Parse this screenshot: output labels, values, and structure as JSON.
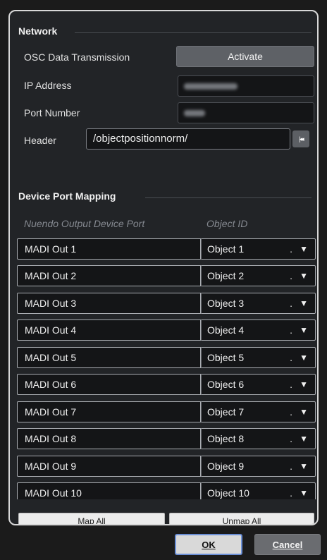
{
  "network": {
    "title": "Network",
    "osc_label": "OSC Data Transmission",
    "activate_label": "Activate",
    "ip_label": "IP Address",
    "port_label": "Port Number",
    "header_label": "Header",
    "header_value": "/objectpositionnorm/",
    "reset_icon": "|◂◂"
  },
  "mapping": {
    "title": "Device Port Mapping",
    "col_port": "Nuendo Output Device Port",
    "col_object": "Object ID",
    "rows": [
      {
        "port": "MADI Out 1",
        "object": "Object 1"
      },
      {
        "port": "MADI Out 2",
        "object": "Object 2"
      },
      {
        "port": "MADI Out 3",
        "object": "Object 3"
      },
      {
        "port": "MADI Out 4",
        "object": "Object 4"
      },
      {
        "port": "MADI Out 5",
        "object": "Object 5"
      },
      {
        "port": "MADI Out 6",
        "object": "Object 6"
      },
      {
        "port": "MADI Out 7",
        "object": "Object 7"
      },
      {
        "port": "MADI Out 8",
        "object": "Object 8"
      },
      {
        "port": "MADI Out 9",
        "object": "Object 9"
      },
      {
        "port": "MADI Out 10",
        "object": "Object 10"
      }
    ],
    "map_all_label": "Map All",
    "unmap_all_label": "Unmap All"
  },
  "dialog": {
    "ok_label": "OK",
    "cancel_label": "Cancel"
  }
}
